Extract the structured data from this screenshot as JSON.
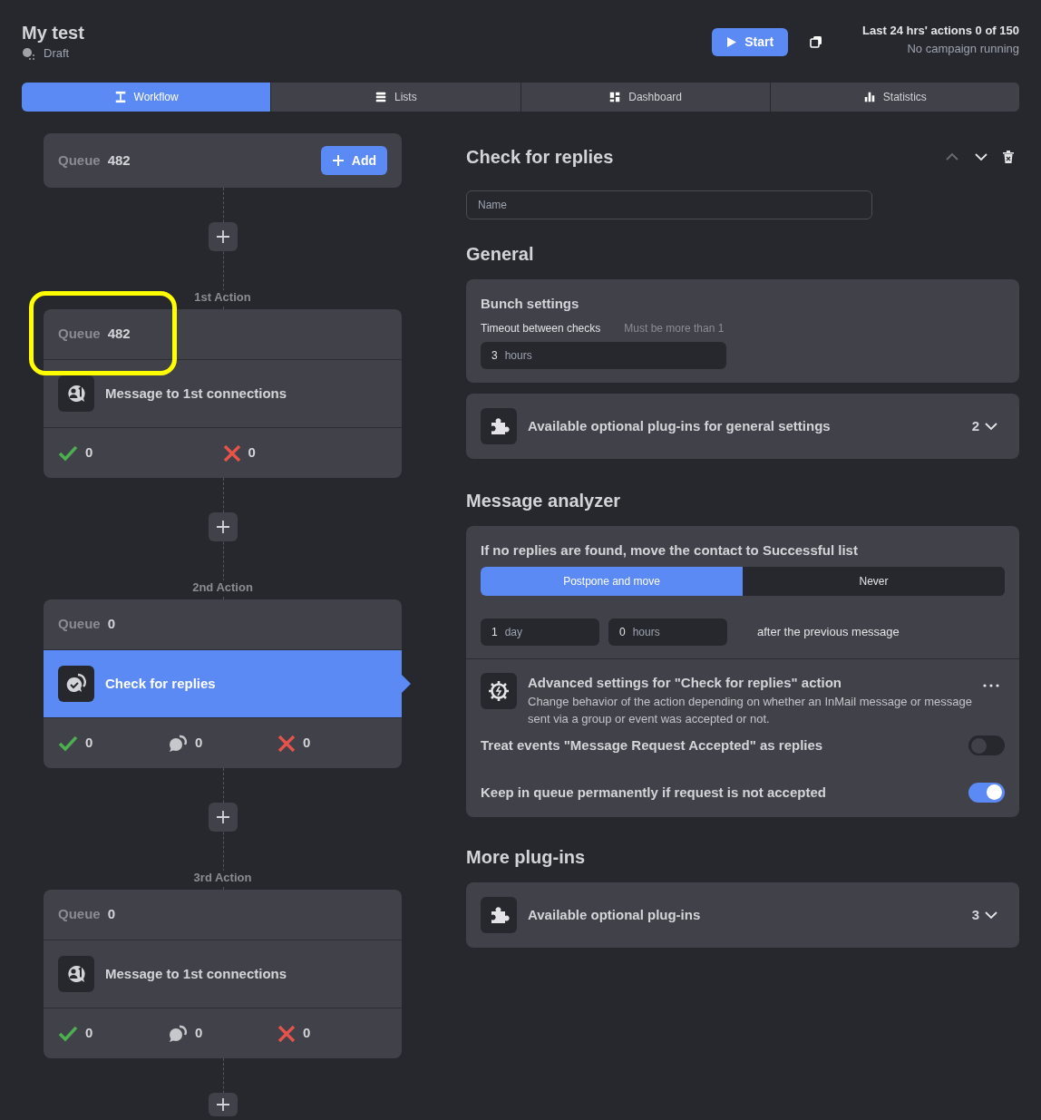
{
  "header": {
    "title": "My test",
    "status": "Draft",
    "start_button": "Start",
    "actions_summary": "Last 24 hrs' actions 0 of 150",
    "campaign_status": "No campaign running"
  },
  "tabs": [
    {
      "label": "Workflow",
      "kind": "workflow",
      "selected": true
    },
    {
      "label": "Lists",
      "kind": "lists",
      "selected": false
    },
    {
      "label": "Dashboard",
      "kind": "dashboard",
      "selected": false
    },
    {
      "label": "Statistics",
      "kind": "statistics",
      "selected": false
    }
  ],
  "workflow": {
    "queue_label": "Queue",
    "queue_count": "482",
    "add_button": "Add",
    "actions": [
      {
        "step": "1st Action",
        "queue_label": "Queue",
        "queue_count": "482",
        "highlighted": true,
        "kind": "message",
        "name": "Message to 1st connections",
        "selected": false,
        "stats": [
          {
            "kind": "success",
            "value": "0"
          },
          {
            "kind": "failed",
            "value": "0"
          }
        ]
      },
      {
        "step": "2nd Action",
        "queue_label": "Queue",
        "queue_count": "0",
        "highlighted": false,
        "kind": "check",
        "name": "Check for replies",
        "selected": true,
        "stats": [
          {
            "kind": "success",
            "value": "0"
          },
          {
            "kind": "replied",
            "value": "0"
          },
          {
            "kind": "failed",
            "value": "0"
          }
        ]
      },
      {
        "step": "3rd Action",
        "queue_label": "Queue",
        "queue_count": "0",
        "highlighted": false,
        "kind": "message",
        "name": "Message to 1st connections",
        "selected": false,
        "stats": [
          {
            "kind": "success",
            "value": "0"
          },
          {
            "kind": "replied",
            "value": "0"
          },
          {
            "kind": "failed",
            "value": "0"
          }
        ]
      }
    ]
  },
  "details": {
    "title": "Check for replies",
    "name_placeholder": "Name",
    "general": {
      "heading": "General",
      "bunch_title": "Bunch settings",
      "timeout_label": "Timeout between checks",
      "timeout_hint": "Must be more than 1",
      "timeout_value": "3",
      "timeout_unit": "hours",
      "plugins_label": "Available optional plug-ins for general settings",
      "plugins_count": "2"
    },
    "analyzer": {
      "heading": "Message analyzer",
      "question": "If no replies are found, move the contact to Successful list",
      "options": [
        {
          "label": "Postpone and move",
          "selected": true
        },
        {
          "label": "Never",
          "selected": false
        }
      ],
      "delay": [
        {
          "value": "1",
          "unit": "day"
        },
        {
          "value": "0",
          "unit": "hours"
        }
      ],
      "delay_suffix": "after the previous message",
      "advanced_title": "Advanced settings for \"Check for replies\" action",
      "advanced_description": "Change behavior of the action depending on whether an InMail message or message sent via a group or event was accepted or not.",
      "toggles": [
        {
          "label": "Treat events \"Message Request Accepted\" as replies",
          "on": false
        },
        {
          "label": "Keep in queue permanently if request is not accepted",
          "on": true
        }
      ]
    },
    "more": {
      "heading": "More plug-ins",
      "plugins_label": "Available optional plug-ins",
      "plugins_count": "3"
    }
  }
}
